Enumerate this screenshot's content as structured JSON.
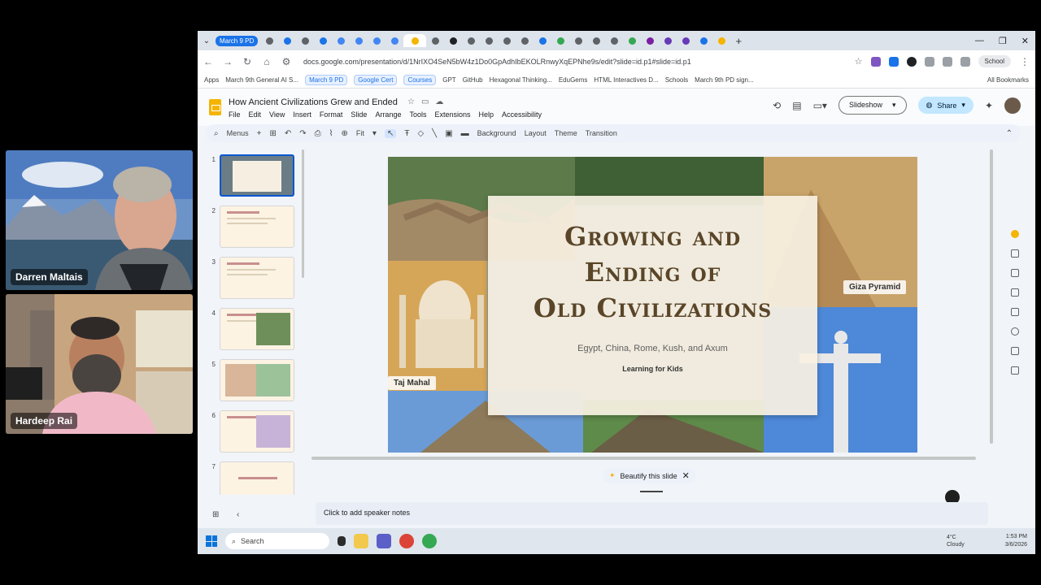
{
  "participants": [
    {
      "name": "Darren Maltais"
    },
    {
      "name": "Hardeep Rai"
    }
  ],
  "browser": {
    "tab_group": "March 9 PD",
    "url": "docs.google.com/presentation/d/1NrIXO4SeN5bW4z1Do0GpAdhIbEKOLRnwyXqEPNhe9s/edit?slide=id.p1#slide=id.p1",
    "profile": "School",
    "bookmarks": [
      "Apps",
      "March 9th General AI S...",
      "March 9 PD",
      "Google Cert",
      "Courses",
      "GPT",
      "GitHub",
      "Hexagonal Thinking...",
      "EduGems",
      "HTML Interactives D...",
      "Schools",
      "March 9th PD sign..."
    ],
    "all_bookmarks": "All Bookmarks"
  },
  "doc": {
    "title": "How Ancient Civilizations Grew and Ended",
    "menus": [
      "File",
      "Edit",
      "View",
      "Insert",
      "Format",
      "Slide",
      "Arrange",
      "Tools",
      "Extensions",
      "Help",
      "Accessibility"
    ],
    "slideshow": "Slideshow",
    "share": "Share"
  },
  "toolbar": {
    "menus_label": "Menus",
    "zoom": "Fit",
    "background": "Background",
    "layout": "Layout",
    "theme": "Theme",
    "transition": "Transition"
  },
  "filmstrip": {
    "slides": [
      "1",
      "2",
      "3",
      "4",
      "5",
      "6",
      "7"
    ],
    "selected": "1"
  },
  "slide": {
    "title": "Growing and\nEnding of\nOld Civilizations",
    "subtitle": "Egypt, China, Rome, Kush, and Axum",
    "tagline": "Learning for Kids",
    "captions": {
      "giza": "Giza Pyramid",
      "taj": "Taj Mahal"
    }
  },
  "beautify": "Beautify this slide",
  "speaker_notes": "Click to add speaker notes",
  "taskbar": {
    "search": "Search",
    "temp": "4°C",
    "weather": "Cloudy",
    "time": "1:53 PM",
    "date": "3/6/2026"
  },
  "colors": {
    "accent": "#1a73e8",
    "share_bg": "#c2e7ff",
    "slide_title": "#5a4528"
  }
}
